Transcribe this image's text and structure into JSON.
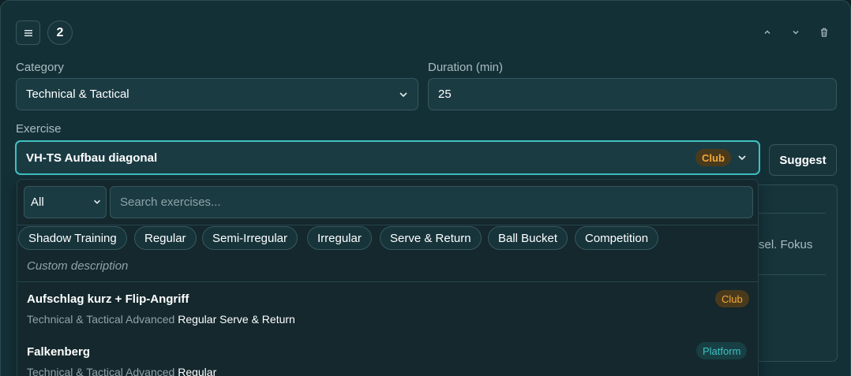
{
  "header": {
    "block_number": "2"
  },
  "category": {
    "label": "Category",
    "value": "Technical & Tactical"
  },
  "duration": {
    "label": "Duration (min)",
    "value": "25"
  },
  "exercise": {
    "label": "Exercise",
    "value": "VH-TS Aufbau diagonal",
    "tag": "Club",
    "suggest_label": "Suggest"
  },
  "background": {
    "partial_text": "sel. Fokus"
  },
  "dropdown": {
    "filter_value": "All",
    "search_placeholder": "Search exercises...",
    "chips": [
      "Shadow Training",
      "Regular",
      "Semi-Irregular",
      "Irregular",
      "Serve & Return",
      "Ball Bucket",
      "Competition"
    ],
    "custom_description": "Custom description",
    "results": [
      {
        "title": "Aufschlag kurz + Flip-Angriff",
        "category": "Technical & Tactical Advanced",
        "tags": "Regular Serve & Return",
        "source": "Club"
      },
      {
        "title": "Falkenberg",
        "category": "Technical & Tactical Advanced",
        "tags": "Regular",
        "source": "Platform"
      }
    ]
  },
  "colors": {
    "accent": "#3fc1c0",
    "club": "#f3a83a",
    "platform": "#3fc1c0",
    "card_bg": "#143037"
  }
}
